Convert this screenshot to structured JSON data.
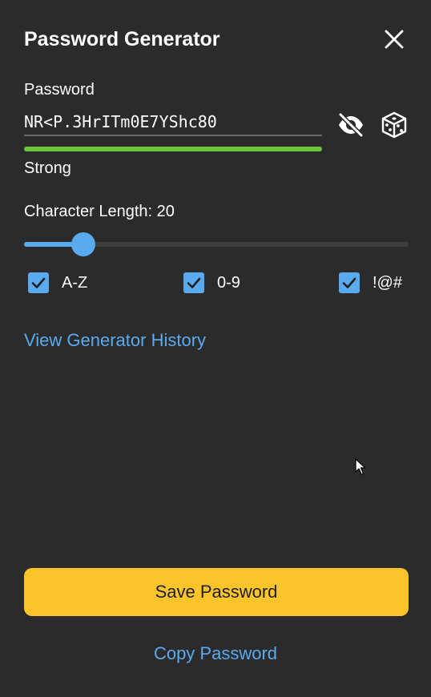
{
  "header": {
    "title": "Password Generator",
    "close_icon": "close-icon"
  },
  "password": {
    "label": "Password",
    "value": "NR<P.3HrITm0E7YShc80",
    "strength_label": "Strong",
    "strength_fraction": 1.0,
    "strength_color": "#6cc83a",
    "visibility_icon": "eye-slash-icon",
    "regenerate_icon": "dice-icon"
  },
  "length": {
    "label": "Character Length: 20",
    "value": 20,
    "slider_fraction": 0.155
  },
  "options": [
    {
      "label": "A-Z",
      "checked": true
    },
    {
      "label": "0-9",
      "checked": true
    },
    {
      "label": "!@#",
      "checked": true
    }
  ],
  "links": {
    "history": "View Generator History",
    "copy": "Copy Password"
  },
  "actions": {
    "save": "Save Password"
  },
  "colors": {
    "background": "#2b2b2b",
    "accent": "#5aaaf0",
    "primary_button": "#fbc42a"
  }
}
